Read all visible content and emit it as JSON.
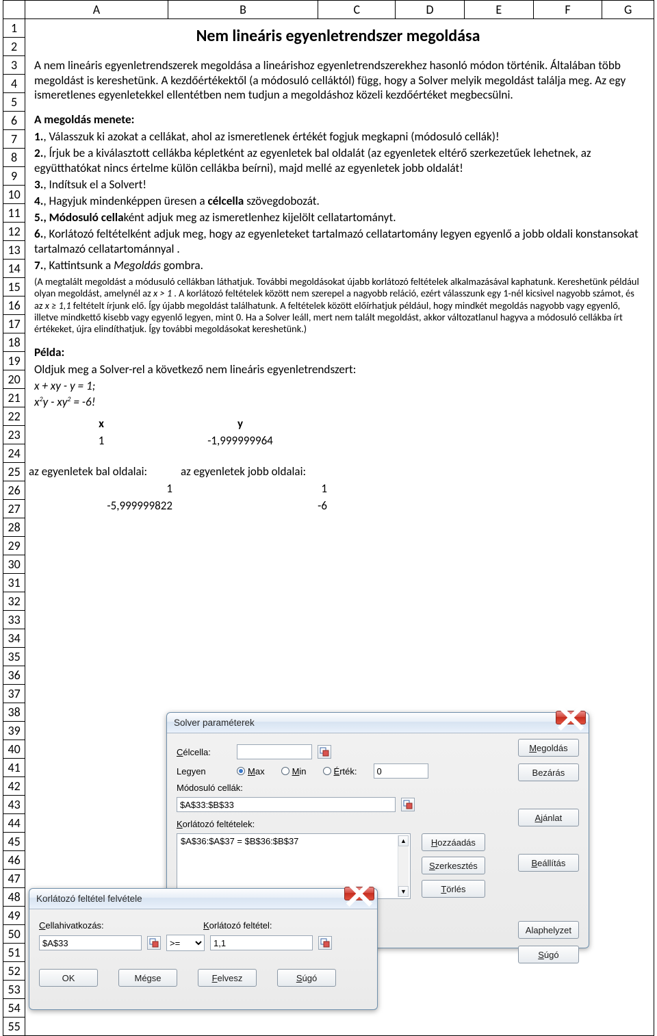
{
  "columns": [
    "A",
    "B",
    "C",
    "D",
    "E",
    "F",
    "G"
  ],
  "row_count": 55,
  "doc": {
    "title": "Nem lineáris egyenletrendszer megoldása",
    "intro": "A nem lineáris egyenletrendszerek megoldása a lineárishoz egyenletrendszerekhez hasonló módon történik. Általában több megoldást is kereshetünk. A kezdőértékektől (a módosuló celláktól) függ, hogy a Solver melyik megoldást találja meg. Az egy ismeretlenes egyenletekkel ellentétben nem tudjun a megoldáshoz közeli kezdőértéket megbecsülni.",
    "steps_title": "A megoldás menete:",
    "step1_prefix": "1.",
    "step1": ", Válasszuk ki azokat a cellákat, ahol az ismeretlenek értékét fogjuk megkapni (módosuló cellák)!",
    "step2_prefix": "2.",
    "step2": ", Írjuk be a kiválasztott cellákba képletként az egyenletek bal oldalát (az egyenletek eltérő szerkezetűek lehetnek, az együtthatókat nincs értelme külön cellákba beírni), majd mellé az egyenletek jobb oldalát!",
    "step3_prefix": "3.",
    "step3": ", Indítsuk el a Solvert!",
    "step4_prefix": "4.",
    "step4_a": ", Hagyjuk mindenképpen üresen a ",
    "step4_bold": "célcella",
    "step4_b": " szövegdobozát.",
    "step5_prefix": "5.",
    "step5_bold": ", Módosuló cella",
    "step5_rest": "ként adjuk meg az ismeretlenhez kijelölt cellatartományt.",
    "step6_prefix": "6.",
    "step6": ", Korlátozó feltételként adjuk meg, hogy az egyenleteket tartalmazó cellatartomány legyen egyenlő a jobb oldali konstansokat tartalmazó cellatartománnyal .",
    "step7_prefix": "7.",
    "step7_a": ", Kattintsunk a ",
    "step7_italic": "Megoldás",
    "step7_b": " gombra.",
    "fine_a": "(A megtalált megoldást a módusuló cellákban láthatjuk. További megoldásokat újabb korlátozó feltételek alkalmazásával kaphatunk. Kereshetünk például olyan megoldást, amelynél az ",
    "fine_it1": "x > 1",
    "fine_b": " . A korlátozó feltételek között nem szerepel a nagyobb reláció, ezért válasszunk egy 1-nél kicsivel nagyobb számot,  és az ",
    "fine_it2": "x ≥  1,1",
    "fine_c": " feltételt írjunk elő. Így újabb megoldást találhatunk.  A feltételek között előírhatjuk például, hogy mindkét megoldás nagyobb vagy egyenlő, illetve mindkettő kisebb vagy egyenlő legyen, mint 0. Ha a Solver leáll, mert nem talált megoldást, akkor változatlanul hagyva a módosuló cellákba írt értékeket, újra elindíthatjuk. Így további megoldásokat kereshetünk.)",
    "example_title": "Példa:",
    "example_intro": "Oldjuk meg a Solver-rel a következő nem lineáris egyenletrendszert:",
    "eq1": "x + xy - y = 1;",
    "eq2_a": "x",
    "eq2_b": "y - xy",
    "eq2_c": " = -6!",
    "table_hdr_x": "x",
    "table_hdr_y": "y",
    "val_x": "1",
    "val_y": "-1,999999964",
    "row35_a": "az egyenletek bal oldalai:",
    "row35_b": "az egyenletek jobb oldalai:",
    "row36_a": "1",
    "row36_b": "1",
    "row37_a": "-5,999999822",
    "row37_b": "-6"
  },
  "solver": {
    "title": "Solver paraméterek",
    "celcella_lbl_u": "C",
    "celcella_lbl": "élcella:",
    "celcella_val": "",
    "legyen": "Legyen",
    "max_u": "M",
    "max_t": "ax",
    "min_u": "M",
    "min_t": "in",
    "ertek_u": "É",
    "ertek_t": "rték:",
    "ertek_val": "0",
    "mod_lbl": "Módosuló cellák:",
    "mod_val": "$A$33:$B$33",
    "korl_lbl_u": "K",
    "korl_lbl": "orlátozó feltételek:",
    "constraint_item": "$A$36:$A$37 = $B$36:$B$37",
    "btn_megoldas": "Megoldás",
    "btn_bezaras": "Bezárás",
    "btn_ajanlat_u": "A",
    "btn_ajanlat": "jánlat",
    "btn_beallitas_u": "B",
    "btn_beallitas": "eállítás",
    "btn_hozzaadas_u": "H",
    "btn_hozzaadas": "ozzáadás",
    "btn_szerk_u": "S",
    "btn_szerk": "zerkesztés",
    "btn_torles_u": "T",
    "btn_torles": "örlés",
    "btn_alap": "Alaphelyzet",
    "btn_sugo_u": "S",
    "btn_sugo": "úgó"
  },
  "constraint_dlg": {
    "title": "Korlátozó feltétel felvétele",
    "ref_lbl_u": "C",
    "ref_lbl": "ellahivatkozás:",
    "ref_val": "$A$33",
    "op": ">=",
    "feltetel_lbl_u": "K",
    "feltetel_lbl": "orlátozó feltétel:",
    "feltetel_val": "1,1",
    "btn_ok": "OK",
    "btn_megse": "Mégse",
    "btn_felvesz_u": "F",
    "btn_felvesz": "elvesz",
    "btn_sugo_u": "S",
    "btn_sugo": "úgó"
  }
}
